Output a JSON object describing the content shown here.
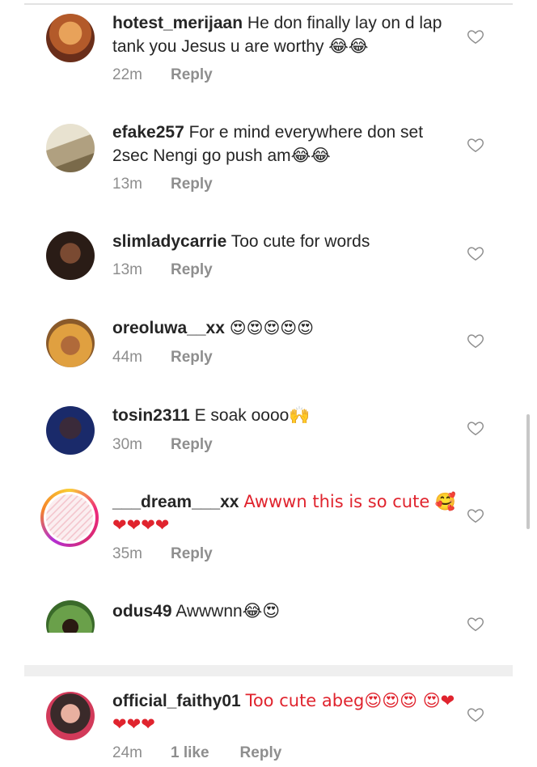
{
  "comments": [
    {
      "username": "hotest_merijaan",
      "text": "He don finally lay on d lap tank you Jesus u are worthy 😂😂",
      "time": "22m",
      "likes": "",
      "reply": "Reply",
      "avatar_color": "#d98a3c"
    },
    {
      "username": "efake257",
      "text": "For e mind everywhere don set 2sec Nengi go push am😂😂",
      "time": "13m",
      "likes": "",
      "reply": "Reply",
      "avatar_color": "#a89a7a"
    },
    {
      "username": "slimladycarrie",
      "text": "Too cute for words",
      "time": "13m",
      "likes": "",
      "reply": "Reply",
      "avatar_color": "#3a2a22"
    },
    {
      "username": "oreoluwa__xx",
      "text": "😍😍😍😍😍",
      "time": "44m",
      "likes": "",
      "reply": "Reply",
      "avatar_color": "#c98a2c"
    },
    {
      "username": "tosin2311",
      "text": "E soak oooo🙌",
      "time": "30m",
      "likes": "",
      "reply": "Reply",
      "avatar_color": "#1f2a55"
    },
    {
      "username": "___dream___xx",
      "text": "Awwwn this is so cute 🥰 ❤❤❤❤",
      "time": "35m",
      "likes": "",
      "reply": "Reply",
      "avatar_color": "#f4c9d0"
    },
    {
      "username": "odus49",
      "text": "Awwwnn😂😍",
      "time": "",
      "likes": "",
      "reply": "",
      "avatar_color": "#4a7a3a"
    },
    {
      "username": "official_faithy01",
      "text": "Too cute abeg😍😍😍 😍❤❤❤❤",
      "time": "24m",
      "likes": "1 like",
      "reply": "Reply",
      "avatar_color": "#d44a5a"
    }
  ],
  "icons": {
    "like": "heart-outline-icon"
  },
  "colors": {
    "text": "#262626",
    "meta": "#8e8e8e",
    "heart_red": "#e0242e"
  }
}
